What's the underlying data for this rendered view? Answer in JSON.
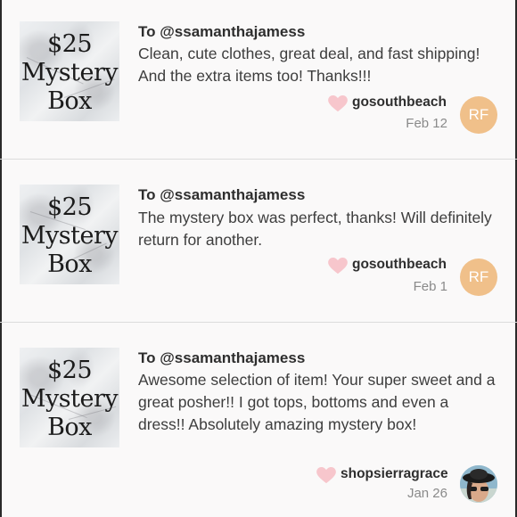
{
  "reviews": [
    {
      "thumbnail": {
        "line1": "$25",
        "line2": "Mystery",
        "line3": "Box"
      },
      "to": "To @ssamanthajamess",
      "text": "Clean, cute clothes, great deal, and fast shipping! And the extra items too! Thanks!!!",
      "username": "gosouthbeach",
      "date": "Feb 12",
      "avatar_initials": "RF"
    },
    {
      "thumbnail": {
        "line1": "$25",
        "line2": "Mystery",
        "line3": "Box"
      },
      "to": "To @ssamanthajamess",
      "text": "The mystery box was perfect, thanks! Will definitely return for another.",
      "username": "gosouthbeach",
      "date": "Feb 1",
      "avatar_initials": "RF"
    },
    {
      "thumbnail": {
        "line1": "$25",
        "line2": "Mystery",
        "line3": "Box"
      },
      "to": "To @ssamanthajamess",
      "text": "Awesome selection of item! Your super sweet and a great posher!! I got tops, bottoms and even a dress!! Absolutely amazing mystery box!",
      "username": "shopsierragrace",
      "date": "Jan 26",
      "avatar_initials": ""
    }
  ],
  "colors": {
    "heart": "#f7c6cc",
    "avatar_initials_bg": "#f0c08a",
    "divider": "#dcdcdc"
  },
  "icons": {
    "like": "heart-icon",
    "user_photo": "avatar-photo"
  }
}
